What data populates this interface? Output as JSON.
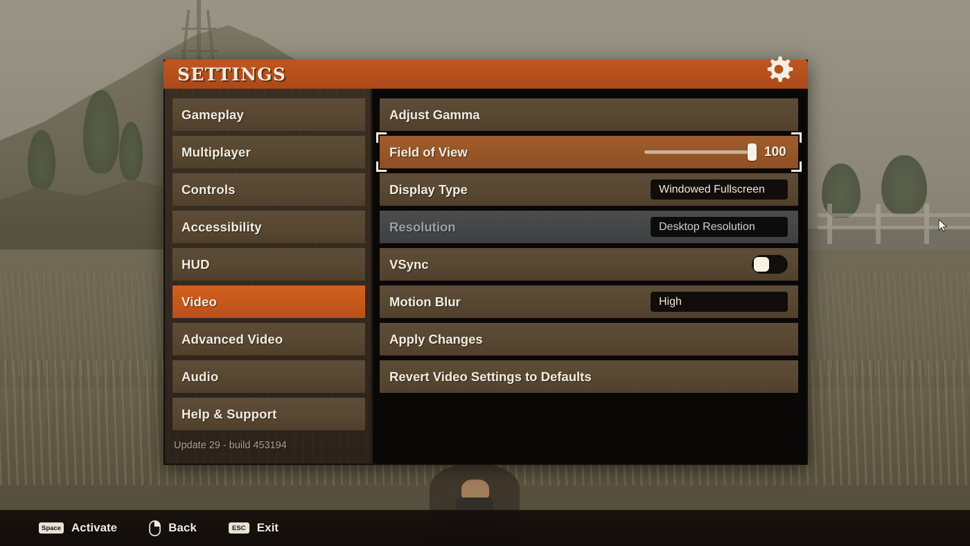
{
  "window": {
    "title": "SETTINGS",
    "gear_icon": "gear-icon"
  },
  "sidebar": {
    "items": [
      {
        "label": "Gameplay",
        "active": false
      },
      {
        "label": "Multiplayer",
        "active": false
      },
      {
        "label": "Controls",
        "active": false
      },
      {
        "label": "Accessibility",
        "active": false
      },
      {
        "label": "HUD",
        "active": false
      },
      {
        "label": "Video",
        "active": true
      },
      {
        "label": "Advanced Video",
        "active": false
      },
      {
        "label": "Audio",
        "active": false
      },
      {
        "label": "Help & Support",
        "active": false
      }
    ],
    "build_info": "Update 29 - build 453194"
  },
  "settings": {
    "rows": [
      {
        "label": "Adjust Gamma",
        "type": "action",
        "state": "normal"
      },
      {
        "label": "Field of View",
        "type": "slider",
        "state": "selected",
        "value": "100",
        "slider_percent": 100
      },
      {
        "label": "Display Type",
        "type": "dropdown",
        "state": "normal",
        "value": "Windowed Fullscreen"
      },
      {
        "label": "Resolution",
        "type": "dropdown",
        "state": "disabled",
        "value": "Desktop Resolution"
      },
      {
        "label": "VSync",
        "type": "toggle",
        "state": "normal",
        "toggle_on": false
      },
      {
        "label": "Motion Blur",
        "type": "dropdown",
        "state": "normal",
        "value": "High"
      },
      {
        "label": "Apply Changes",
        "type": "action",
        "state": "normal"
      },
      {
        "label": "Revert Video Settings to Defaults",
        "type": "action",
        "state": "normal"
      }
    ]
  },
  "hints": [
    {
      "key": "Space",
      "icon": "key-badge",
      "label": "Activate"
    },
    {
      "key": "",
      "icon": "mouse-right-button-icon",
      "label": "Back"
    },
    {
      "key": "ESC",
      "icon": "key-badge",
      "label": "Exit"
    }
  ],
  "colors": {
    "accent_orange": "#c4571b",
    "row_brown": "#574731",
    "selected_brown": "#965527",
    "disabled_grey": "#444547",
    "cream_text": "#f3ece1",
    "panel_black": "#0a0807"
  }
}
